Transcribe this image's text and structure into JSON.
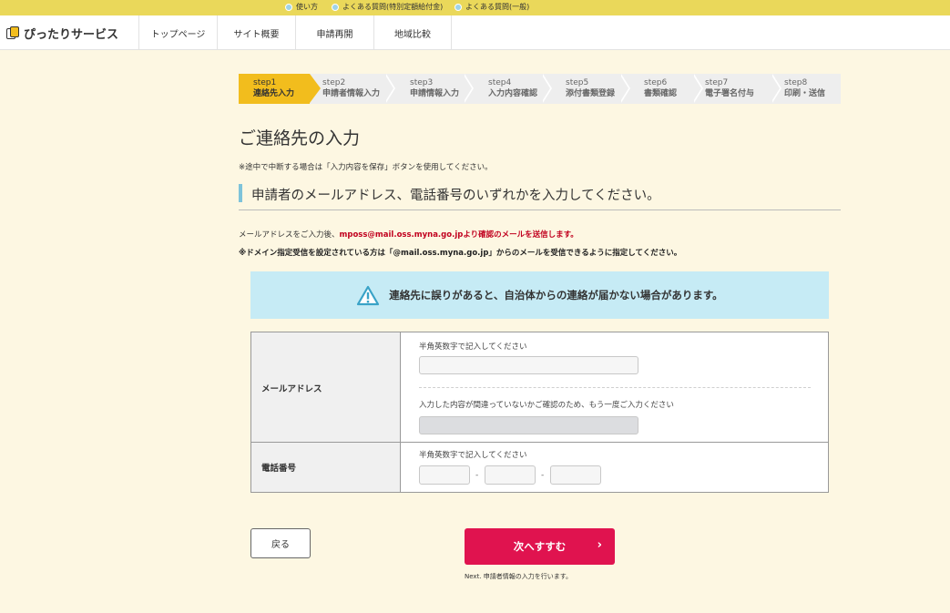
{
  "topbar": {
    "links": [
      "使い方",
      "よくある質問(特別定額給付金)",
      "よくある質問(一般)"
    ]
  },
  "header": {
    "logo_text": "ぴったりサービス",
    "nav": [
      "トップページ",
      "サイト概要",
      "申請再開",
      "地域比較"
    ]
  },
  "steps": [
    {
      "num": "step1",
      "label": "連絡先入力",
      "active": true
    },
    {
      "num": "step2",
      "label": "申請者情報入力",
      "active": false
    },
    {
      "num": "step3",
      "label": "申請情報入力",
      "active": false
    },
    {
      "num": "step4",
      "label": "入力内容確認",
      "active": false
    },
    {
      "num": "step5",
      "label": "添付書類登録",
      "active": false
    },
    {
      "num": "step6",
      "label": "書類確認",
      "active": false
    },
    {
      "num": "step7",
      "label": "電子署名付与",
      "active": false
    },
    {
      "num": "step8",
      "label": "印刷・送信",
      "active": false
    }
  ],
  "page": {
    "title": "ご連絡先の入力",
    "note": "※途中で中断する場合は「入力内容を保存」ボタンを使用してください。",
    "subheading": "申請者のメールアドレス、電話番号のいずれかを入力してください。",
    "info_prefix": "メールアドレスをご入力後、",
    "info_highlight": "mposs@mail.oss.myna.go.jpより確認のメールを送信します。",
    "info_domain": "※ドメイン指定受信を設定されている方は「@mail.oss.myna.go.jp」からのメールを受信できるように指定してください。",
    "warning": "連絡先に誤りがあると、自治体からの連絡が届かない場合があります。"
  },
  "form": {
    "email_label": "メールアドレス",
    "email_hint": "半角英数字で記入してください",
    "email_value": "",
    "email_confirm_hint": "入力した内容が間違っていないかご確認のため、もう一度ご入力ください",
    "email_confirm_value": "",
    "phone_label": "電話番号",
    "phone_hint": "半角英数字で記入してください",
    "phone_values": [
      "",
      "",
      ""
    ],
    "phone_separator": "-"
  },
  "buttons": {
    "back": "戻る",
    "next": "次へすすむ",
    "next_note": "Next. 申請者情報の入力を行います。"
  },
  "colors": {
    "topbar": "#ead85a",
    "background": "#fdf7e2",
    "step_active": "#f2bd1d",
    "warning_bg": "#c6ebf5",
    "next_button": "#e0134f",
    "highlight_red": "#c1001e"
  }
}
